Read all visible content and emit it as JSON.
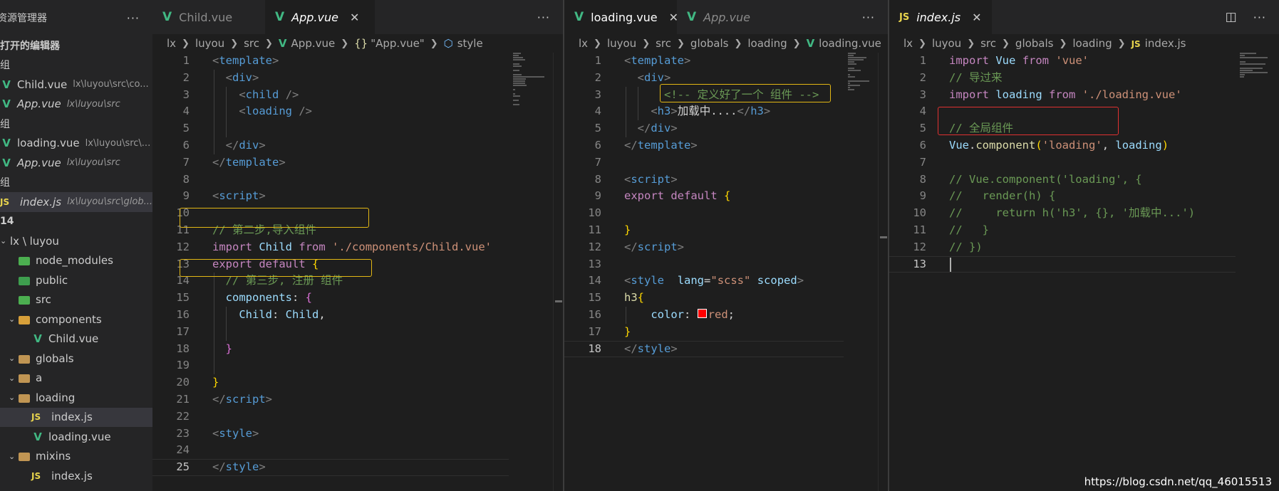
{
  "sidebar": {
    "title": "资源管理器",
    "more": "···",
    "open_editors_label": "打开的编辑器",
    "rows": [
      {
        "kind": "group",
        "label": "组"
      },
      {
        "kind": "vue",
        "name": "Child.vue",
        "desc": "lx\\luyou\\src\\co..."
      },
      {
        "kind": "vue",
        "name": "App.vue",
        "desc": "lx\\luyou\\src",
        "italic": true
      },
      {
        "kind": "group",
        "label": "组"
      },
      {
        "kind": "vue",
        "name": "loading.vue",
        "desc": "lx\\luyou\\src\\..."
      },
      {
        "kind": "vue",
        "name": "App.vue",
        "desc": "lx\\luyou\\src",
        "italic": true
      },
      {
        "kind": "group",
        "label": "组"
      },
      {
        "kind": "js",
        "name": "index.js",
        "desc": "lx\\luyou\\src\\glob...",
        "italic": true,
        "active": true
      }
    ],
    "workspace_label": "14",
    "tree": [
      {
        "indent": 0,
        "chev": "⌄",
        "icon": "none",
        "name": "lx \\ luyou"
      },
      {
        "indent": 1,
        "chev": "",
        "icon": "green",
        "name": "node_modules"
      },
      {
        "indent": 1,
        "chev": "",
        "icon": "teal",
        "name": "public"
      },
      {
        "indent": 1,
        "chev": "",
        "icon": "green",
        "name": "src"
      },
      {
        "indent": 1,
        "chev": "⌄",
        "icon": "orange",
        "name": "components"
      },
      {
        "indent": 2,
        "chev": "",
        "icon": "vue",
        "name": "Child.vue"
      },
      {
        "indent": 1,
        "chev": "⌄",
        "icon": "plain",
        "name": "globals"
      },
      {
        "indent": 1,
        "chev": "⌄",
        "icon": "plain",
        "name": "a"
      },
      {
        "indent": 1,
        "chev": "⌄",
        "icon": "plain",
        "name": "loading"
      },
      {
        "indent": 2,
        "chev": "",
        "icon": "js",
        "name": "index.js",
        "active": true
      },
      {
        "indent": 2,
        "chev": "",
        "icon": "vue",
        "name": "loading.vue"
      },
      {
        "indent": 1,
        "chev": "⌄",
        "icon": "plain",
        "name": "mixins"
      },
      {
        "indent": 2,
        "chev": "",
        "icon": "js",
        "name": "index.js"
      }
    ]
  },
  "pane1": {
    "tabs": [
      {
        "label": "Child.vue",
        "icon": "vue",
        "active": false,
        "italic": false,
        "close": false
      },
      {
        "label": "App.vue",
        "icon": "vue",
        "active": true,
        "italic": true,
        "close": true
      }
    ],
    "breadcrumb": [
      "lx",
      "luyou",
      "src",
      "App.vue",
      "\"App.vue\"",
      "style"
    ],
    "lines": [
      [
        [
          "t-punct",
          "<"
        ],
        [
          "t-tag",
          "template"
        ],
        [
          "t-punct",
          ">"
        ]
      ],
      [
        [
          "t-plain",
          "  "
        ],
        [
          "t-punct",
          "<"
        ],
        [
          "t-tag",
          "div"
        ],
        [
          "t-punct",
          ">"
        ]
      ],
      [
        [
          "t-plain",
          "    "
        ],
        [
          "t-punct",
          "<"
        ],
        [
          "t-tag",
          "child"
        ],
        [
          "t-plain",
          " "
        ],
        [
          "t-punct",
          "/>"
        ]
      ],
      [
        [
          "t-plain",
          "    "
        ],
        [
          "t-punct",
          "<"
        ],
        [
          "t-tag",
          "loading"
        ],
        [
          "t-plain",
          " "
        ],
        [
          "t-punct",
          "/>"
        ]
      ],
      [],
      [
        [
          "t-plain",
          "  "
        ],
        [
          "t-punct",
          "</"
        ],
        [
          "t-tag",
          "div"
        ],
        [
          "t-punct",
          ">"
        ]
      ],
      [
        [
          "t-punct",
          "</"
        ],
        [
          "t-tag",
          "template"
        ],
        [
          "t-punct",
          ">"
        ]
      ],
      [],
      [
        [
          "t-punct",
          "<"
        ],
        [
          "t-tag",
          "script"
        ],
        [
          "t-punct",
          ">"
        ]
      ],
      [],
      [
        [
          "t-com",
          "// 第二步,导入组件"
        ]
      ],
      [
        [
          "t-key",
          "import"
        ],
        [
          "t-plain",
          " "
        ],
        [
          "t-id",
          "Child"
        ],
        [
          "t-plain",
          " "
        ],
        [
          "t-key",
          "from"
        ],
        [
          "t-plain",
          " "
        ],
        [
          "t-str",
          "'./components/Child.vue'"
        ]
      ],
      [
        [
          "t-key",
          "export"
        ],
        [
          "t-plain",
          " "
        ],
        [
          "t-key",
          "default"
        ],
        [
          "t-plain",
          " "
        ],
        [
          "t-brace",
          "{"
        ]
      ],
      [
        [
          "t-plain",
          "  "
        ],
        [
          "t-com",
          "// 第三步, 注册 组件"
        ]
      ],
      [
        [
          "t-plain",
          "  "
        ],
        [
          "t-id",
          "components"
        ],
        [
          "t-plain",
          ": "
        ],
        [
          "t-brace2",
          "{"
        ]
      ],
      [
        [
          "t-plain",
          "    "
        ],
        [
          "t-id",
          "Child"
        ],
        [
          "t-plain",
          ": "
        ],
        [
          "t-id",
          "Child"
        ],
        [
          "t-plain",
          ","
        ]
      ],
      [],
      [
        [
          "t-plain",
          "  "
        ],
        [
          "t-brace2",
          "}"
        ]
      ],
      [],
      [
        [
          "t-brace",
          "}"
        ]
      ],
      [
        [
          "t-punct",
          "</"
        ],
        [
          "t-tag",
          "script"
        ],
        [
          "t-punct",
          ">"
        ]
      ],
      [],
      [
        [
          "t-punct",
          "<"
        ],
        [
          "t-tag",
          "style"
        ],
        [
          "t-punct",
          ">"
        ]
      ],
      [],
      [
        [
          "t-punct",
          "</"
        ],
        [
          "t-tag",
          "style"
        ],
        [
          "t-punct",
          ">"
        ]
      ]
    ],
    "current_line": 25
  },
  "pane2": {
    "tabs": [
      {
        "label": "loading.vue",
        "icon": "vue",
        "active": true,
        "italic": false,
        "close": true
      },
      {
        "label": "App.vue",
        "icon": "vue",
        "active": false,
        "italic": true,
        "close": false
      }
    ],
    "breadcrumb": [
      "lx",
      "luyou",
      "src",
      "globals",
      "loading",
      "loading.vue",
      "\""
    ],
    "lines": [
      [
        [
          "t-punct",
          "<"
        ],
        [
          "t-tag",
          "template"
        ],
        [
          "t-punct",
          ">"
        ]
      ],
      [
        [
          "t-plain",
          "  "
        ],
        [
          "t-punct",
          "<"
        ],
        [
          "t-tag",
          "div"
        ],
        [
          "t-punct",
          ">"
        ]
      ],
      [
        [
          "t-plain",
          "      "
        ],
        [
          "t-com",
          "<!-- 定义好了一个 组件 -->"
        ]
      ],
      [
        [
          "t-plain",
          "    "
        ],
        [
          "t-punct",
          "<"
        ],
        [
          "t-tag",
          "h3"
        ],
        [
          "t-punct",
          ">"
        ],
        [
          "t-plain",
          "加载中...."
        ],
        [
          "t-punct",
          "</"
        ],
        [
          "t-tag",
          "h3"
        ],
        [
          "t-punct",
          ">"
        ]
      ],
      [
        [
          "t-plain",
          "  "
        ],
        [
          "t-punct",
          "</"
        ],
        [
          "t-tag",
          "div"
        ],
        [
          "t-punct",
          ">"
        ]
      ],
      [
        [
          "t-punct",
          "</"
        ],
        [
          "t-tag",
          "template"
        ],
        [
          "t-punct",
          ">"
        ]
      ],
      [],
      [
        [
          "t-punct",
          "<"
        ],
        [
          "t-tag",
          "script"
        ],
        [
          "t-punct",
          ">"
        ]
      ],
      [
        [
          "t-key",
          "export"
        ],
        [
          "t-plain",
          " "
        ],
        [
          "t-key",
          "default"
        ],
        [
          "t-plain",
          " "
        ],
        [
          "t-brace",
          "{"
        ]
      ],
      [],
      [
        [
          "t-brace",
          "}"
        ]
      ],
      [
        [
          "t-punct",
          "</"
        ],
        [
          "t-tag",
          "script"
        ],
        [
          "t-punct",
          ">"
        ]
      ],
      [],
      [
        [
          "t-punct",
          "<"
        ],
        [
          "t-tag",
          "style"
        ],
        [
          "t-plain",
          "  "
        ],
        [
          "t-id",
          "lang"
        ],
        [
          "t-plain",
          "="
        ],
        [
          "t-str",
          "\"scss\""
        ],
        [
          "t-plain",
          " "
        ],
        [
          "t-id",
          "scoped"
        ],
        [
          "t-punct",
          ">"
        ]
      ],
      [
        [
          "t-fn",
          "h3"
        ],
        [
          "t-brace",
          "{"
        ]
      ],
      [
        [
          "t-plain",
          "    "
        ],
        [
          "t-id",
          "color"
        ],
        [
          "t-plain",
          ": "
        ],
        [
          "swatch",
          ""
        ],
        [
          "t-str",
          "red"
        ],
        [
          "t-plain",
          ";"
        ]
      ],
      [
        [
          "t-brace",
          "}"
        ]
      ],
      [
        [
          "t-punct",
          "</"
        ],
        [
          "t-tag",
          "style"
        ],
        [
          "t-punct",
          ">"
        ]
      ]
    ],
    "current_line": 18
  },
  "pane3": {
    "tabs": [
      {
        "label": "index.js",
        "icon": "js",
        "active": true,
        "italic": true,
        "close": true
      }
    ],
    "breadcrumb": [
      "lx",
      "luyou",
      "src",
      "globals",
      "loading",
      "index.js"
    ],
    "lines": [
      [
        [
          "t-key",
          "import"
        ],
        [
          "t-plain",
          " "
        ],
        [
          "t-id",
          "Vue"
        ],
        [
          "t-plain",
          " "
        ],
        [
          "t-key",
          "from"
        ],
        [
          "t-plain",
          " "
        ],
        [
          "t-str",
          "'vue'"
        ]
      ],
      [
        [
          "t-com",
          "// 导过来"
        ]
      ],
      [
        [
          "t-key",
          "import"
        ],
        [
          "t-plain",
          " "
        ],
        [
          "t-id",
          "loading"
        ],
        [
          "t-plain",
          " "
        ],
        [
          "t-key",
          "from"
        ],
        [
          "t-plain",
          " "
        ],
        [
          "t-str",
          "'./loading.vue'"
        ]
      ],
      [],
      [
        [
          "t-com",
          "// 全局组件"
        ]
      ],
      [
        [
          "t-id",
          "Vue"
        ],
        [
          "t-plain",
          "."
        ],
        [
          "t-fn",
          "component"
        ],
        [
          "t-brace",
          "("
        ],
        [
          "t-str",
          "'loading'"
        ],
        [
          "t-plain",
          ", "
        ],
        [
          "t-id",
          "loading"
        ],
        [
          "t-brace",
          ")"
        ]
      ],
      [],
      [
        [
          "t-com",
          "// Vue.component('loading', {"
        ]
      ],
      [
        [
          "t-com",
          "//   render(h) {"
        ]
      ],
      [
        [
          "t-com",
          "//     return h('h3', {}, '加载中...')"
        ]
      ],
      [
        [
          "t-com",
          "//   }"
        ]
      ],
      [
        [
          "t-com",
          "// })"
        ]
      ],
      []
    ],
    "current_line": 13
  },
  "watermark": "https://blog.csdn.net/qq_46015513",
  "colors": {
    "highlight_yellow": "#e2b714",
    "highlight_red": "#e03131",
    "vue_green": "#41b883",
    "js_yellow": "#e8d44d"
  }
}
